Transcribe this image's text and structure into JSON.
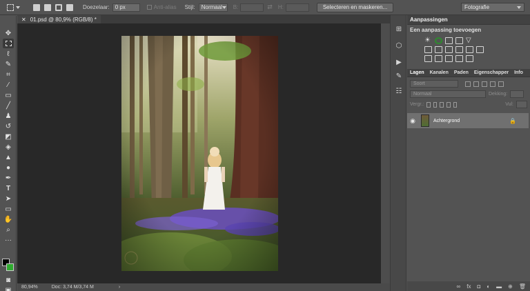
{
  "options_bar": {
    "feather_label": "Doezelaar:",
    "feather_value": "0 px",
    "antialias_label": "Anti-alias",
    "style_label": "Stijl:",
    "style_value": "Normaal",
    "width_label": "B:",
    "height_label": "H:",
    "select_mask_label": "Selecteren en maskeren...",
    "workspace_value": "Fotografie"
  },
  "document": {
    "tab_label": "01.psd @ 80,9% (RGB/8) *",
    "zoom": "80,94%",
    "doc_size": "Doc: 3,74 M/3,74 M"
  },
  "adjustments": {
    "title": "Aanpassingen",
    "subtitle": "Een aanpassing toevoegen"
  },
  "layers_panel": {
    "tabs": [
      "Lagen",
      "Kanalen",
      "Paden",
      "Eigenschapper",
      "Info"
    ],
    "filter_placeholder": "Soort",
    "blend_mode": "Normaal",
    "opacity_label": "Dekking:",
    "lock_label": "Vergr.:",
    "fill_label": "Vul:",
    "layer_name": "Achtergrond"
  },
  "tools": [
    "move-icon",
    "marquee-icon",
    "lasso-icon",
    "quick-select-icon",
    "crop-icon",
    "eyedropper-icon",
    "spot-heal-icon",
    "brush-icon",
    "stamp-icon",
    "history-brush-icon",
    "eraser-icon",
    "gradient-icon",
    "blur-icon",
    "dodge-icon",
    "pen-icon",
    "type-icon",
    "path-select-icon",
    "shape-icon",
    "hand-icon",
    "zoom-icon"
  ],
  "colors": {
    "foreground": "#000000",
    "background": "#2faa2f",
    "accent_circle": "#2e8b2e"
  }
}
